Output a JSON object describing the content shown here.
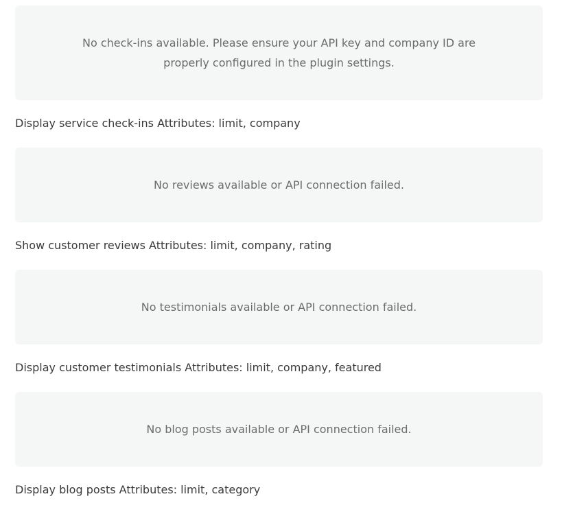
{
  "sections": [
    {
      "notice": "No check-ins available. Please ensure your API key and company ID are properly configured in the plugin settings.",
      "description": "Display service check-ins Attributes: limit, company"
    },
    {
      "notice": "No reviews available or API connection failed.",
      "description": "Show customer reviews Attributes: limit, company, rating"
    },
    {
      "notice": "No testimonials available or API connection failed.",
      "description": "Display customer testimonials Attributes: limit, company, featured"
    },
    {
      "notice": "No blog posts available or API connection failed.",
      "description": "Display blog posts Attributes: limit, category"
    }
  ]
}
